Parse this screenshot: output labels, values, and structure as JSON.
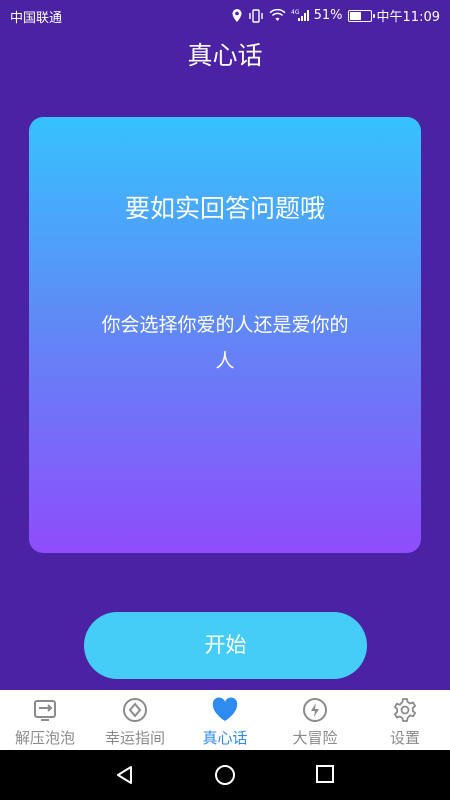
{
  "status_bar": {
    "carrier": "中国联通",
    "battery": "51%",
    "time": "中午11:09"
  },
  "header": {
    "title": "真心话"
  },
  "card": {
    "heading": "要如实回答问题哦",
    "question_line1": "你会选择你爱的人还是爱你的",
    "question_line2": "人"
  },
  "start_button": {
    "label": "开始"
  },
  "tabs": [
    {
      "label": "解压泡泡",
      "icon": "bubble-frame-icon",
      "active": false
    },
    {
      "label": "幸运指间",
      "icon": "compass-icon",
      "active": false
    },
    {
      "label": "真心话",
      "icon": "heart-icon",
      "active": true
    },
    {
      "label": "大冒险",
      "icon": "lightning-icon",
      "active": false
    },
    {
      "label": "设置",
      "icon": "gear-icon",
      "active": false
    }
  ],
  "nav_bar": {
    "icons": [
      "back-icon",
      "home-icon",
      "recents-icon"
    ]
  },
  "colors": {
    "background": "#4a22a3",
    "card_gradient_top": "#36c2fe",
    "card_gradient_bottom": "#8f4cfb",
    "button": "#46cdf7",
    "active_tab": "#2e8bf0",
    "inactive_tab": "#8b8b8b"
  }
}
